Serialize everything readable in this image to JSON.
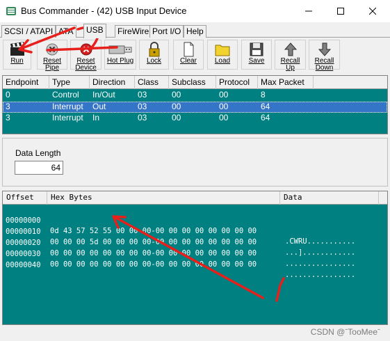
{
  "window": {
    "title": "Bus Commander - (42) USB Input Device"
  },
  "tabs": [
    {
      "label": "SCSI / ATAPI"
    },
    {
      "label": "ATA"
    },
    {
      "label": "USB"
    },
    {
      "label": "FireWire"
    },
    {
      "label": "Port I/O"
    },
    {
      "label": "Help"
    }
  ],
  "toolbar": [
    {
      "label": "Run",
      "icon": "clapperboard-icon"
    },
    {
      "label": "Reset\nPipe",
      "icon": "reset-pipe-icon"
    },
    {
      "label": "Reset\nDevice",
      "icon": "reset-device-icon"
    },
    {
      "label": "Hot Plug",
      "icon": "usb-plug-icon"
    },
    {
      "label": "Lock",
      "icon": "padlock-icon"
    },
    {
      "label": "Clear",
      "icon": "blank-page-icon"
    },
    {
      "label": "Load",
      "icon": "folder-icon"
    },
    {
      "label": "Save",
      "icon": "floppy-disk-icon"
    },
    {
      "label": "Recall\nUp",
      "icon": "arrow-up-icon"
    },
    {
      "label": "Recall\nDown",
      "icon": "arrow-down-icon"
    }
  ],
  "endpoints": {
    "headers": [
      "Endpoint",
      "Type",
      "Direction",
      "Class",
      "Subclass",
      "Protocol",
      "Max Packet"
    ],
    "rows": [
      [
        "0",
        "Control",
        "In/Out",
        "03",
        "00",
        "00",
        "8"
      ],
      [
        "3",
        "Interrupt",
        "Out",
        "03",
        "00",
        "00",
        "64"
      ],
      [
        "3",
        "Interrupt",
        "In",
        "03",
        "00",
        "00",
        "64"
      ]
    ],
    "selected_row": 1
  },
  "data_length": {
    "label": "Data Length",
    "value": "64"
  },
  "hexdump": {
    "headers": [
      "Offset",
      "Hex Bytes",
      "Data"
    ],
    "lines": [
      {
        "offset": "00000000",
        "bytes": "0d 43 57 52 55 00 00 00-00 00 00 00 00 00 00 00",
        "ascii": ".CWRU..........."
      },
      {
        "offset": "00000010",
        "bytes": "00 00 00 5d 00 00 00 00-00 00 00 00 00 00 00 00",
        "ascii": "...]............"
      },
      {
        "offset": "00000020",
        "bytes": "00 00 00 00 00 00 00 00-00 00 00 00 00 00 00 00",
        "ascii": "................"
      },
      {
        "offset": "00000030",
        "bytes": "00 00 00 00 00 00 00 00-00 00 00 00 00 00 00 00",
        "ascii": "................"
      },
      {
        "offset": "00000040",
        "bytes": "",
        "ascii": ""
      }
    ]
  },
  "watermark": "CSDN @ˉTooMeeˉ",
  "colors": {
    "grid_bg": "#008080",
    "selection": "#3575c8",
    "annotation": "#e8201c"
  }
}
